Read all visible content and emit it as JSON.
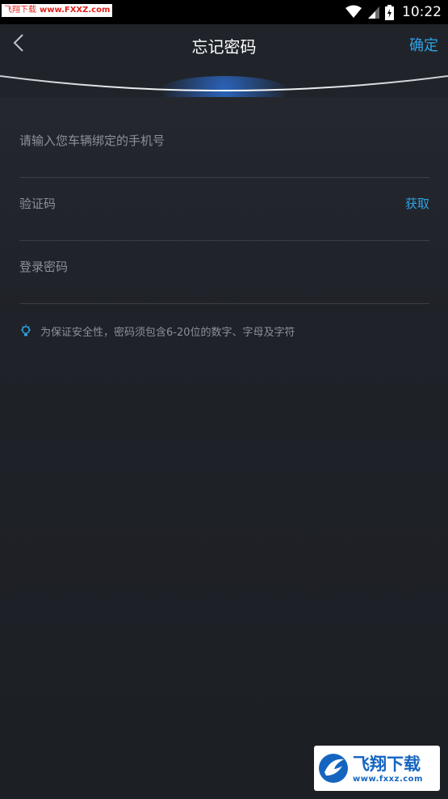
{
  "watermark_top": {
    "brand": "飞翔下载",
    "site": "www.FXXZ.com"
  },
  "status_bar": {
    "time": "10:22"
  },
  "nav": {
    "title": "忘记密码",
    "confirm_label": "确定"
  },
  "form": {
    "phone_placeholder": "请输入您车辆绑定的手机号",
    "code_placeholder": "验证码",
    "get_code_label": "获取",
    "password_placeholder": "登录密码"
  },
  "tip": {
    "text": "为保证安全性，密码须包含6-20位的数字、字母及字符"
  },
  "watermark_bottom": {
    "brand": "飞翔下载",
    "url": "www.fxxz.com"
  },
  "colors": {
    "accent": "#2fa3e6",
    "background": "#1f2228",
    "divider": "#3a3e46"
  }
}
